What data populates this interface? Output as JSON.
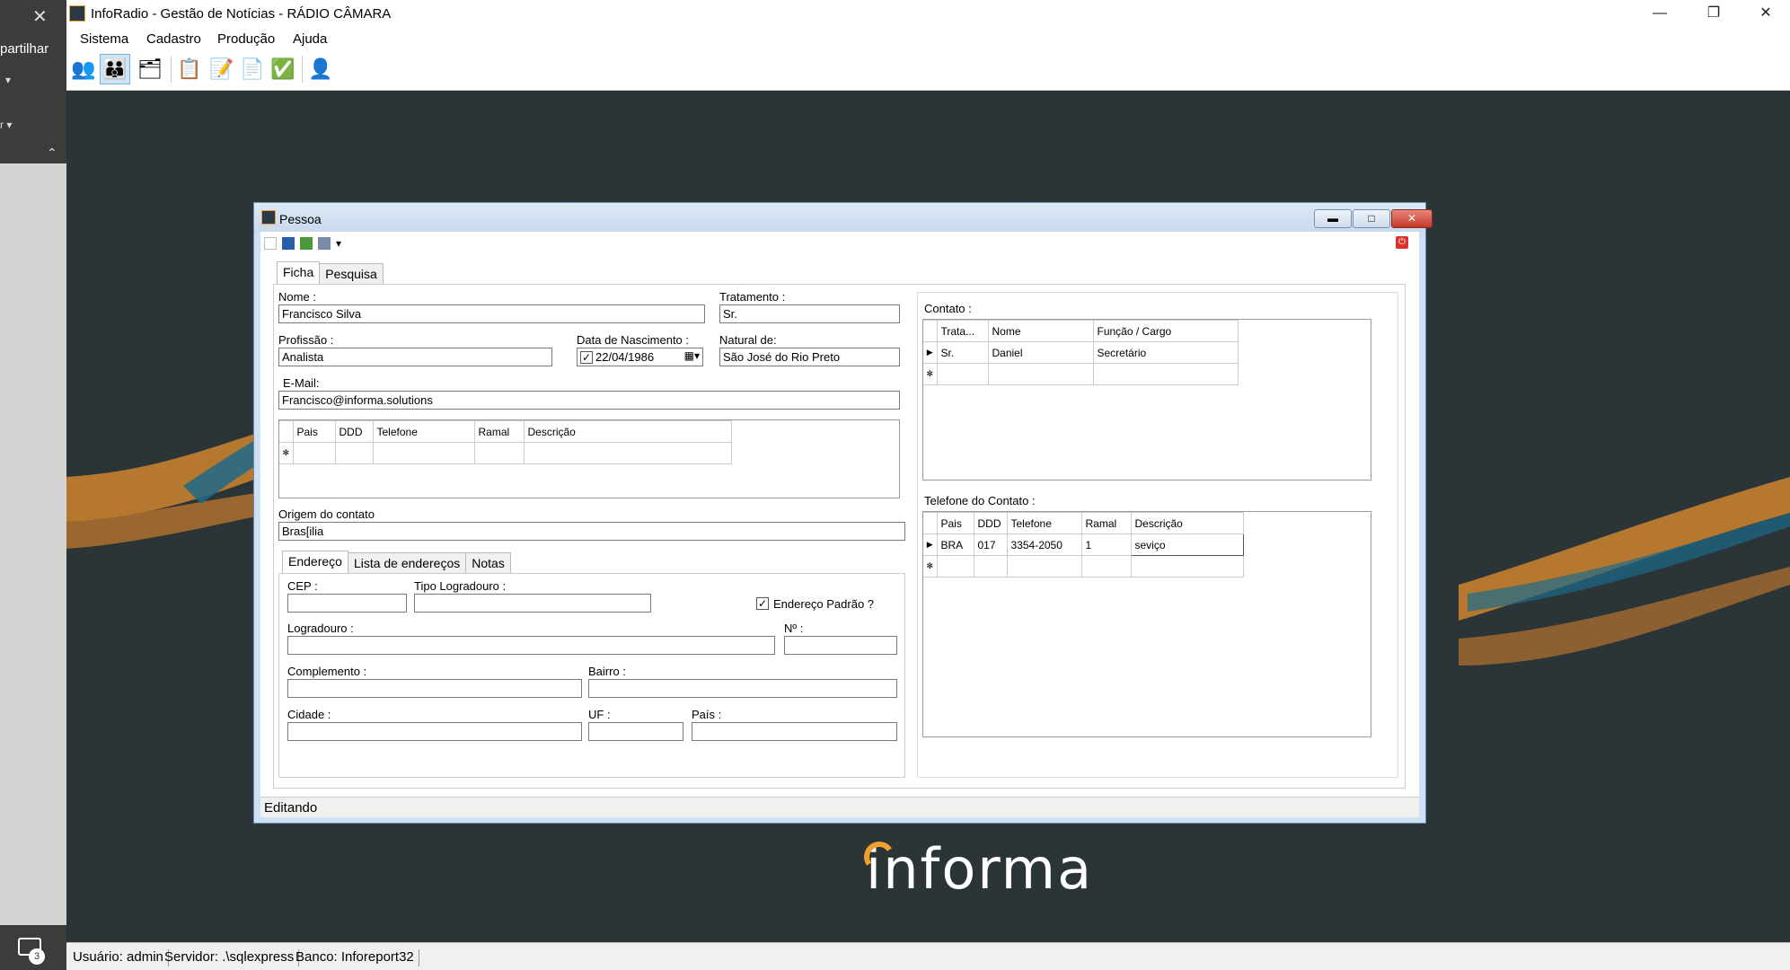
{
  "app": {
    "title": "InfoRadio - Gestão de Notícias - RÁDIO CÂMARA",
    "menu": [
      "Sistema",
      "Cadastro",
      "Produção",
      "Ajuda"
    ]
  },
  "background_app": {
    "close_glyph": "✕",
    "share_label": "partilhar",
    "notifications_count": "3"
  },
  "window_controls": {
    "minimize": "—",
    "restore": "❐",
    "close": "✕"
  },
  "statusbar": {
    "user": "Usuário: admin",
    "server": "Servidor: .\\sqlexpress",
    "database": "Banco: Inforeport32"
  },
  "logo_text": "informa",
  "dialog": {
    "title": "Pessoa",
    "tabs": [
      "Ficha",
      "Pesquisa"
    ],
    "status": "Editando",
    "fields": {
      "nome": {
        "label": "Nome :",
        "value": "Francisco Silva"
      },
      "tratamento": {
        "label": "Tratamento :",
        "value": "Sr."
      },
      "profissao": {
        "label": "Profissão :",
        "value": "Analista"
      },
      "nascimento": {
        "label": "Data de Nascimento :",
        "value": "22/04/1986"
      },
      "natural": {
        "label": "Natural de:",
        "value": "São José do Rio Preto"
      },
      "email": {
        "label": "E-Mail:",
        "value": "Francisco@informa.solutions"
      },
      "origem": {
        "label": "Origem do contato",
        "value": "Bras[ilia"
      }
    },
    "phones_grid": {
      "headers": [
        "Pais",
        "DDD",
        "Telefone",
        "Ramal",
        "Descrição"
      ]
    },
    "address_tabs": [
      "Endereço",
      "Lista de endereços",
      "Notas"
    ],
    "address": {
      "cep": "CEP :",
      "tipo_logradouro": "Tipo Logradouro :",
      "endereco_padrao": "Endereço Padrão ?",
      "logradouro": "Logradouro :",
      "numero": "Nº :",
      "complemento": "Complemento :",
      "bairro": "Bairro :",
      "cidade": "Cidade :",
      "uf": "UF :",
      "pais": "País :"
    },
    "contato": {
      "label": "Contato :",
      "headers": [
        "Trata...",
        "Nome",
        "Função / Cargo"
      ],
      "rows": [
        [
          "Sr.",
          "Daniel",
          "Secretário"
        ]
      ]
    },
    "telefone_contato": {
      "label": "Telefone do Contato :",
      "headers": [
        "Pais",
        "DDD",
        "Telefone",
        "Ramal",
        "Descrição"
      ],
      "rows": [
        [
          "BRA",
          "017",
          "3354-2050",
          "1",
          "seviço"
        ]
      ]
    }
  }
}
